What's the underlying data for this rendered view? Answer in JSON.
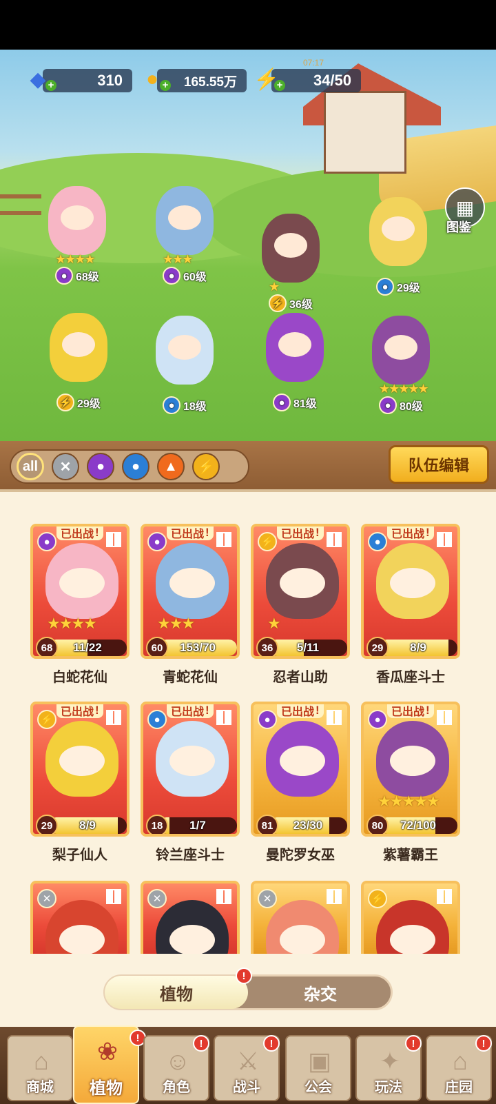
{
  "resources": {
    "gems": {
      "value": "310",
      "icon": "diamond-icon"
    },
    "coins": {
      "value": "165.55万",
      "icon": "coin-icon"
    },
    "energy": {
      "value": "34/50",
      "icon": "lightning-icon",
      "timer": "07:17"
    }
  },
  "atlas": {
    "label": "图鉴",
    "icon": "book-icon"
  },
  "team_units": [
    {
      "level": "68级",
      "element": "poison",
      "stars": "★★★★"
    },
    {
      "level": "60级",
      "element": "poison",
      "stars": "★★★"
    },
    {
      "level": "36级",
      "element": "thunder",
      "stars": "★"
    },
    {
      "level": "29级",
      "element": "water",
      "stars": ""
    },
    {
      "level": "29级",
      "element": "thunder",
      "stars": ""
    },
    {
      "level": "18级",
      "element": "water",
      "stars": ""
    },
    {
      "level": "81级",
      "element": "poison",
      "stars": ""
    },
    {
      "level": "80级",
      "element": "poison",
      "stars": "★★★★★"
    }
  ],
  "filters": [
    {
      "label": "all",
      "icon": "all-icon",
      "color": "#f2c94c"
    },
    {
      "label": "",
      "icon": "sword-icon",
      "color": "#9ea3a8"
    },
    {
      "label": "",
      "icon": "poison-icon",
      "color": "#8a3bc9"
    },
    {
      "label": "",
      "icon": "water-icon",
      "color": "#2b7fd6"
    },
    {
      "label": "",
      "icon": "fire-icon",
      "color": "#f06a1d"
    },
    {
      "label": "",
      "icon": "thunder-icon",
      "color": "#f2b21b"
    }
  ],
  "team_edit": "队伍编辑",
  "deployed_label": "已出战",
  "cards": [
    {
      "name": "白蛇花仙",
      "level": "68",
      "count": "11/22",
      "progress": 0.5,
      "stars": "★★★★",
      "element": "poison",
      "deployed": true,
      "gold": false,
      "art": "#f7b6c5"
    },
    {
      "name": "青蛇花仙",
      "level": "60",
      "count": "153/70",
      "progress": 1.0,
      "stars": "★★★",
      "element": "poison",
      "deployed": true,
      "gold": false,
      "art": "#8fb7e0"
    },
    {
      "name": "忍者山助",
      "level": "36",
      "count": "5/11",
      "progress": 0.45,
      "stars": "★",
      "element": "thunder",
      "deployed": true,
      "gold": false,
      "art": "#7a4a4e"
    },
    {
      "name": "香瓜座斗士",
      "level": "29",
      "count": "8/9",
      "progress": 0.89,
      "stars": "",
      "element": "water",
      "deployed": true,
      "gold": false,
      "art": "#f2d35b"
    },
    {
      "name": "梨子仙人",
      "level": "29",
      "count": "8/9",
      "progress": 0.89,
      "stars": "",
      "element": "thunder",
      "deployed": true,
      "gold": false,
      "art": "#f3cf3b"
    },
    {
      "name": "铃兰座斗士",
      "level": "18",
      "count": "1/7",
      "progress": 0.14,
      "stars": "",
      "element": "water",
      "deployed": true,
      "gold": false,
      "art": "#cfe3f5"
    },
    {
      "name": "曼陀罗女巫",
      "level": "81",
      "count": "23/30",
      "progress": 0.77,
      "stars": "",
      "element": "poison",
      "deployed": true,
      "gold": true,
      "art": "#9a48c8"
    },
    {
      "name": "紫薯霸王",
      "level": "80",
      "count": "72/100",
      "progress": 0.72,
      "stars": "★★★★★",
      "element": "poison",
      "deployed": true,
      "gold": true,
      "art": "#8e4ca0"
    },
    {
      "name": "",
      "level": "",
      "count": "",
      "progress": 0,
      "stars": "",
      "element": "sword",
      "deployed": false,
      "gold": false,
      "art": "#d8452f"
    },
    {
      "name": "",
      "level": "",
      "count": "",
      "progress": 0,
      "stars": "",
      "element": "sword",
      "deployed": false,
      "gold": false,
      "art": "#2c2c36"
    },
    {
      "name": "",
      "level": "",
      "count": "",
      "progress": 0,
      "stars": "",
      "element": "sword",
      "deployed": false,
      "gold": true,
      "art": "#f08a70"
    },
    {
      "name": "",
      "level": "",
      "count": "",
      "progress": 0,
      "stars": "",
      "element": "thunder",
      "deployed": false,
      "gold": true,
      "art": "#c8352a"
    }
  ],
  "toggle": {
    "plants": "植物",
    "hybrid": "杂交"
  },
  "nav": [
    {
      "label": "商城",
      "icon": "shop-icon",
      "badge": false
    },
    {
      "label": "植物",
      "icon": "plant-icon",
      "badge": true
    },
    {
      "label": "角色",
      "icon": "character-icon",
      "badge": true
    },
    {
      "label": "战斗",
      "icon": "battle-icon",
      "badge": true
    },
    {
      "label": "公会",
      "icon": "guild-icon",
      "badge": false
    },
    {
      "label": "玩法",
      "icon": "gameplay-icon",
      "badge": true
    },
    {
      "label": "庄园",
      "icon": "manor-icon",
      "badge": true
    }
  ],
  "badge_symbol": "!"
}
